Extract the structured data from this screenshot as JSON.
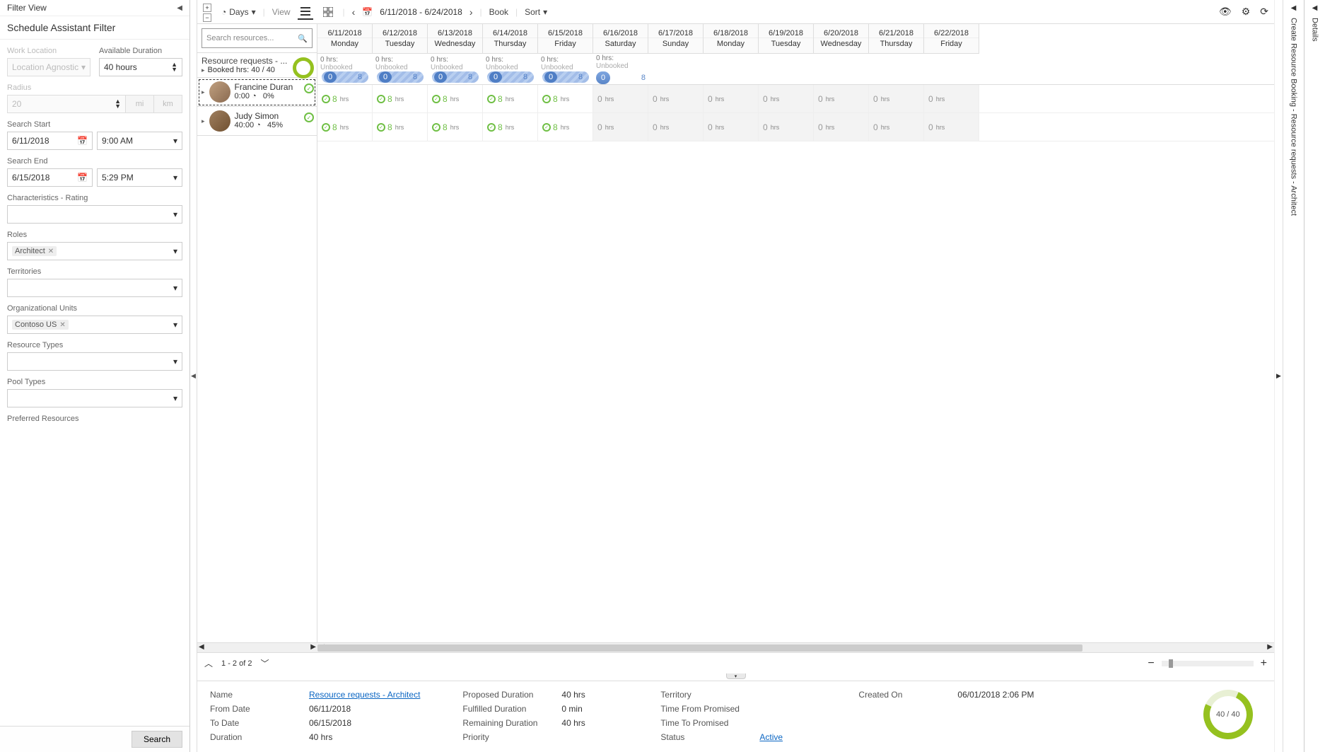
{
  "filterView": {
    "title": "Filter View",
    "subtitle": "Schedule Assistant Filter",
    "workLocation": {
      "label": "Work Location",
      "value": "Location Agnostic"
    },
    "availableDuration": {
      "label": "Available Duration",
      "value": "40 hours"
    },
    "radius": {
      "label": "Radius",
      "value": "20",
      "unit_mi": "mi",
      "unit_km": "km"
    },
    "searchStart": {
      "label": "Search Start",
      "date": "6/11/2018",
      "time": "9:00 AM"
    },
    "searchEnd": {
      "label": "Search End",
      "date": "6/15/2018",
      "time": "5:29 PM"
    },
    "characteristics": {
      "label": "Characteristics - Rating"
    },
    "roles": {
      "label": "Roles",
      "chip": "Architect"
    },
    "territories": {
      "label": "Territories"
    },
    "orgUnits": {
      "label": "Organizational Units",
      "chip": "Contoso US"
    },
    "resourceTypes": {
      "label": "Resource Types"
    },
    "poolTypes": {
      "label": "Pool Types"
    },
    "preferredResources": {
      "label": "Preferred Resources"
    },
    "searchBtn": "Search"
  },
  "toolbar": {
    "daysLabel": "Days",
    "viewLabel": "View",
    "dateRange": "6/11/2018 - 6/24/2018",
    "bookLabel": "Book",
    "sortLabel": "Sort"
  },
  "board": {
    "searchPlaceholder": "Search resources...",
    "summaryTitle": "Resource requests - ...",
    "summaryBooked": "Booked hrs: 40 / 40",
    "unbookedLabelPrefix": "0 hrs:",
    "unbookedLabel": "Unbooked",
    "pillStart": "0",
    "pillEnd": "8",
    "days": [
      {
        "date": "6/11/2018",
        "dow": "Monday"
      },
      {
        "date": "6/12/2018",
        "dow": "Tuesday"
      },
      {
        "date": "6/13/2018",
        "dow": "Wednesday"
      },
      {
        "date": "6/14/2018",
        "dow": "Thursday"
      },
      {
        "date": "6/15/2018",
        "dow": "Friday"
      },
      {
        "date": "6/16/2018",
        "dow": "Saturday"
      },
      {
        "date": "6/17/2018",
        "dow": "Sunday"
      },
      {
        "date": "6/18/2018",
        "dow": "Monday"
      },
      {
        "date": "6/19/2018",
        "dow": "Tuesday"
      },
      {
        "date": "6/20/2018",
        "dow": "Wednesday"
      },
      {
        "date": "6/21/2018",
        "dow": "Thursday"
      },
      {
        "date": "6/22/2018",
        "dow": "Friday"
      }
    ],
    "resources": [
      {
        "name": "Francine Duran",
        "line2a": "0:00",
        "line2b": "0%",
        "hrsGreen": "8",
        "unit": "hrs",
        "grayHrs": "0"
      },
      {
        "name": "Judy Simon",
        "line2a": "40:00",
        "line2b": "45%",
        "hrsGreen": "8",
        "unit": "hrs",
        "grayHrs": "0"
      }
    ]
  },
  "footer": {
    "pager": "1 - 2 of 2"
  },
  "details": {
    "name_k": "Name",
    "name_v": "Resource requests - Architect",
    "from_k": "From Date",
    "from_v": "06/11/2018",
    "to_k": "To Date",
    "to_v": "06/15/2018",
    "dur_k": "Duration",
    "dur_v": "40 hrs",
    "prop_k": "Proposed Duration",
    "prop_v": "40 hrs",
    "ful_k": "Fulfilled Duration",
    "ful_v": "0 min",
    "rem_k": "Remaining Duration",
    "rem_v": "40 hrs",
    "pri_k": "Priority",
    "pri_v": "",
    "ter_k": "Territory",
    "ter_v": "",
    "tfp_k": "Time From Promised",
    "tfp_v": "",
    "ttp_k": "Time To Promised",
    "ttp_v": "",
    "sta_k": "Status",
    "sta_v": "Active",
    "crt_k": "Created On",
    "crt_v": "06/01/2018 2:06 PM",
    "donut": "40 / 40"
  },
  "rails": {
    "create": "Create Resource Booking - Resource requests - Architect",
    "details": "Details"
  }
}
